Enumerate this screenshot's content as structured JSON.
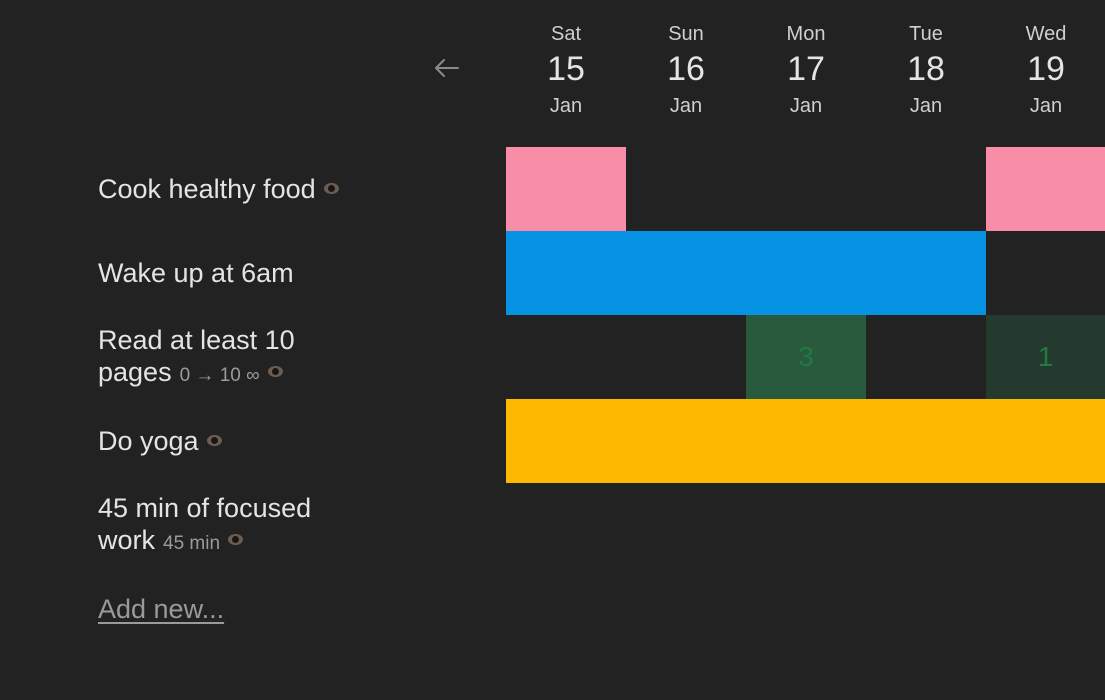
{
  "nav": {
    "back_icon": "arrow-left-icon"
  },
  "days": [
    {
      "dow": "Sat",
      "num": "15",
      "month": "Jan"
    },
    {
      "dow": "Sun",
      "num": "16",
      "month": "Jan"
    },
    {
      "dow": "Mon",
      "num": "17",
      "month": "Jan"
    },
    {
      "dow": "Tue",
      "num": "18",
      "month": "Jan"
    },
    {
      "dow": "Wed",
      "num": "19",
      "month": "Jan"
    }
  ],
  "habits": [
    {
      "name": "Cook healthy food",
      "meta": "",
      "color": "#f78da7",
      "done": [
        true,
        false,
        false,
        false,
        true
      ]
    },
    {
      "name": "Wake up at 6am",
      "meta": "",
      "color": "#0693e3",
      "done": [
        true,
        true,
        true,
        true,
        false
      ]
    },
    {
      "name": "Read at least 10 pages",
      "name_line1": "Read at least 10",
      "name_line2": "pages",
      "meta": "0 → 10 ∞",
      "color": "#2a5a3e",
      "entries": [
        null,
        null,
        "3",
        null,
        "1"
      ]
    },
    {
      "name": "Do yoga",
      "meta": "",
      "color": "#fcb900",
      "done": [
        true,
        true,
        true,
        true,
        true
      ]
    },
    {
      "name": "45 min of focused work",
      "name_line1": "45 min of focused",
      "name_line2": "work",
      "meta": "45 min",
      "color": "",
      "done": [
        false,
        false,
        false,
        false,
        false
      ]
    }
  ],
  "add_new_label": "Add new...",
  "colors": {
    "background": "#222222",
    "pink": "#f78da7",
    "blue": "#0693e3",
    "yellow": "#fcb900",
    "green_strong": "#2a5a3e",
    "green_weak": "#243a2e",
    "green_text": "#1f7a43"
  }
}
